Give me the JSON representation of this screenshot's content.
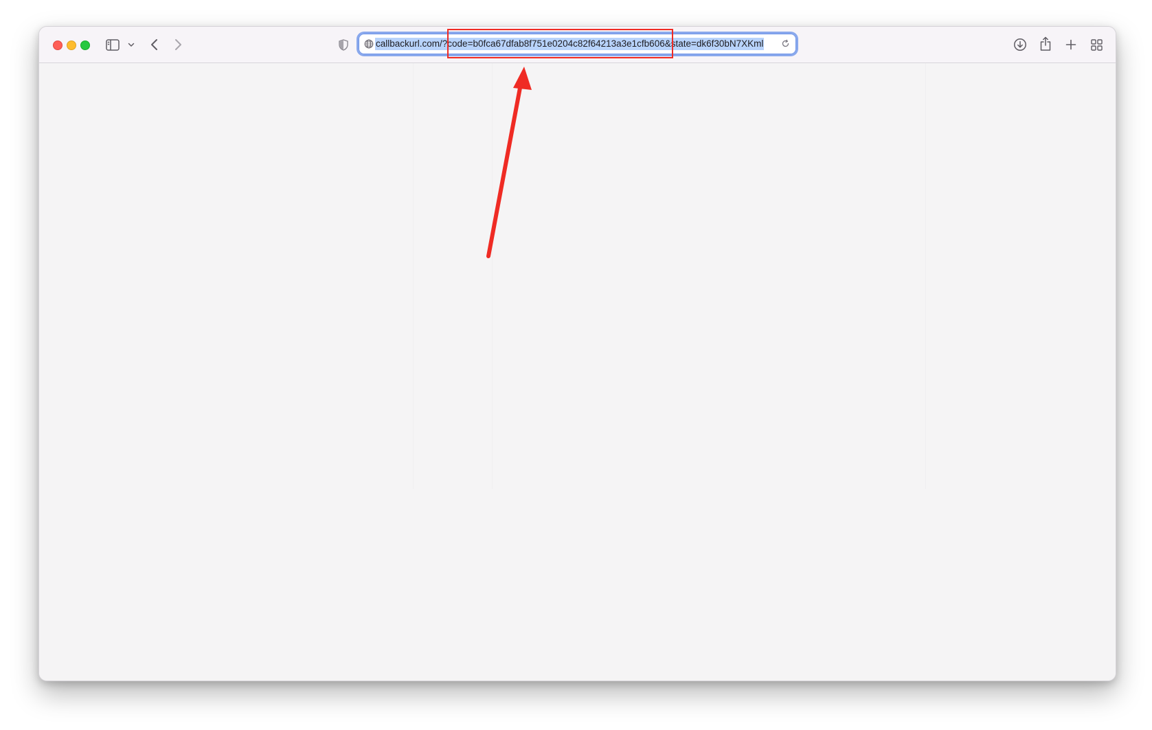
{
  "browser": {
    "url": "callbackurl.com/?code=b0fca67dfab8f751e0204c82f64213a3e1cfb606&state=dk6f30bN7XKml"
  },
  "icons": {
    "close": "close-icon",
    "minimize": "minimize-icon",
    "zoom": "zoom-icon",
    "sidebar": "sidebar-icon",
    "chevron": "chevron-down-icon",
    "back": "back-arrow-icon",
    "forward": "forward-arrow-icon",
    "privacy": "shield-icon",
    "globe": "globe-icon",
    "reload": "reload-icon",
    "download": "download-icon",
    "share": "share-icon",
    "new_tab": "plus-icon",
    "tab_overview": "grid-icon"
  },
  "colors": {
    "annotation": "#ef2b24",
    "url_selection": "#b8d3fb",
    "focus_ring": "#89a8ec"
  }
}
